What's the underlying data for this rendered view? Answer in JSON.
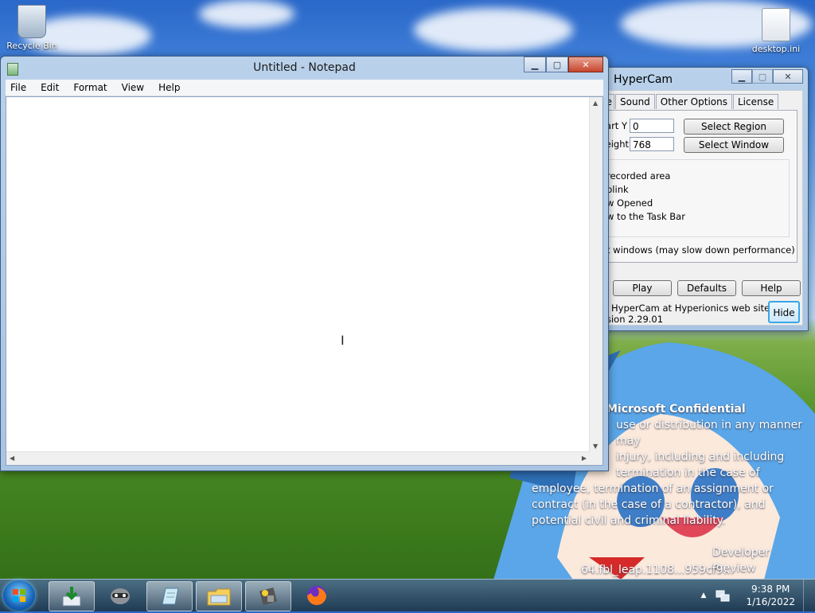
{
  "desktop": {
    "icons": [
      {
        "label": "Recycle Bin",
        "icon": "recycle-bin-icon"
      },
      {
        "label": "desktop.ini",
        "icon": "ini-file-icon"
      }
    ],
    "watermark": {
      "heading": "Microsoft Confidential",
      "lines": [
        "use or distribution in any manner may",
        "injury, including and including",
        "termination in the case of",
        "employee, termination of an assignment or",
        "contract (in the case of a contractor), and",
        "potential civil and criminal liability."
      ],
      "build_line1": "Developer Preview",
      "build_line2": "64.fbl_leap.1108...959cf9..."
    }
  },
  "notepad": {
    "title": "Untitled - Notepad",
    "menu": [
      "File",
      "Edit",
      "Format",
      "View",
      "Help"
    ],
    "content": "",
    "cap_minimize": "▁",
    "cap_maximize": "▢",
    "cap_close": "✕"
  },
  "hypercam": {
    "title": "HyperCam",
    "tabs": [
      "File",
      "Sound",
      "Other Options",
      "License"
    ],
    "start_y_label": "Start Y",
    "start_y_value": "0",
    "height_label": "Height",
    "height_value": "768",
    "select_region": "Select Region",
    "select_window": "Select Window",
    "options": [
      "recorded area",
      "blink",
      "w Opened",
      "w to the Task Bar"
    ],
    "layered_option": "t windows (may slow down performance)",
    "play": "Play",
    "defaults": "Defaults",
    "help": "Help",
    "hide": "Hide",
    "footer_line1": "HyperCam at Hyperionics web site! Click",
    "footer_line2": "sion 2.29.01",
    "cap_minimize": "▁",
    "cap_maximize": "▢",
    "cap_close": "✕"
  },
  "taskbar": {
    "items": [
      {
        "name": "installer",
        "icon": "download-installer-icon"
      },
      {
        "name": "raccoon-app",
        "icon": "raccoon-icon"
      },
      {
        "name": "notepad",
        "icon": "notepad-icon"
      },
      {
        "name": "explorer",
        "icon": "folder-icon"
      },
      {
        "name": "hypercam",
        "icon": "film-camera-icon"
      },
      {
        "name": "firefox",
        "icon": "firefox-icon"
      }
    ],
    "time": "9:38 PM",
    "date": "1/16/2022"
  },
  "colors": {
    "accent": "#3b5c88",
    "close_red": "#c7452c",
    "window_frame": "#b9d1ea"
  }
}
